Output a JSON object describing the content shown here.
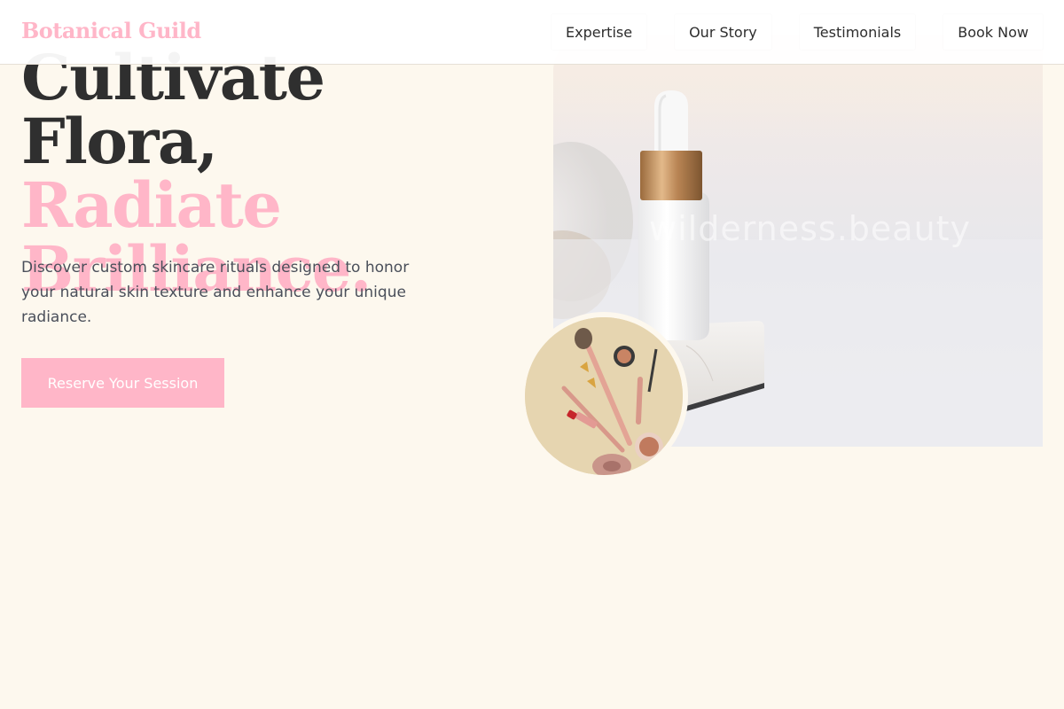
{
  "brand": {
    "name": "Botanical Guild"
  },
  "nav": {
    "items": [
      {
        "label": "Expertise"
      },
      {
        "label": "Our Story"
      },
      {
        "label": "Testimonials"
      },
      {
        "label": "Book Now"
      }
    ]
  },
  "hero": {
    "title_line1": "Cultivate Flora,",
    "title_line2": "Radiate",
    "title_line3": "Brilliance.",
    "description": "Discover custom skincare rituals designed to honor your natural skin texture and enhance your unique radiance.",
    "cta_label": "Reserve Your Session",
    "image_watermark": "wilderness.beauty"
  },
  "colors": {
    "background": "#fdf8ee",
    "accent_pink": "#ffb6c8",
    "text_dark": "#2f2f2f",
    "text_body": "#4a4f5a"
  }
}
